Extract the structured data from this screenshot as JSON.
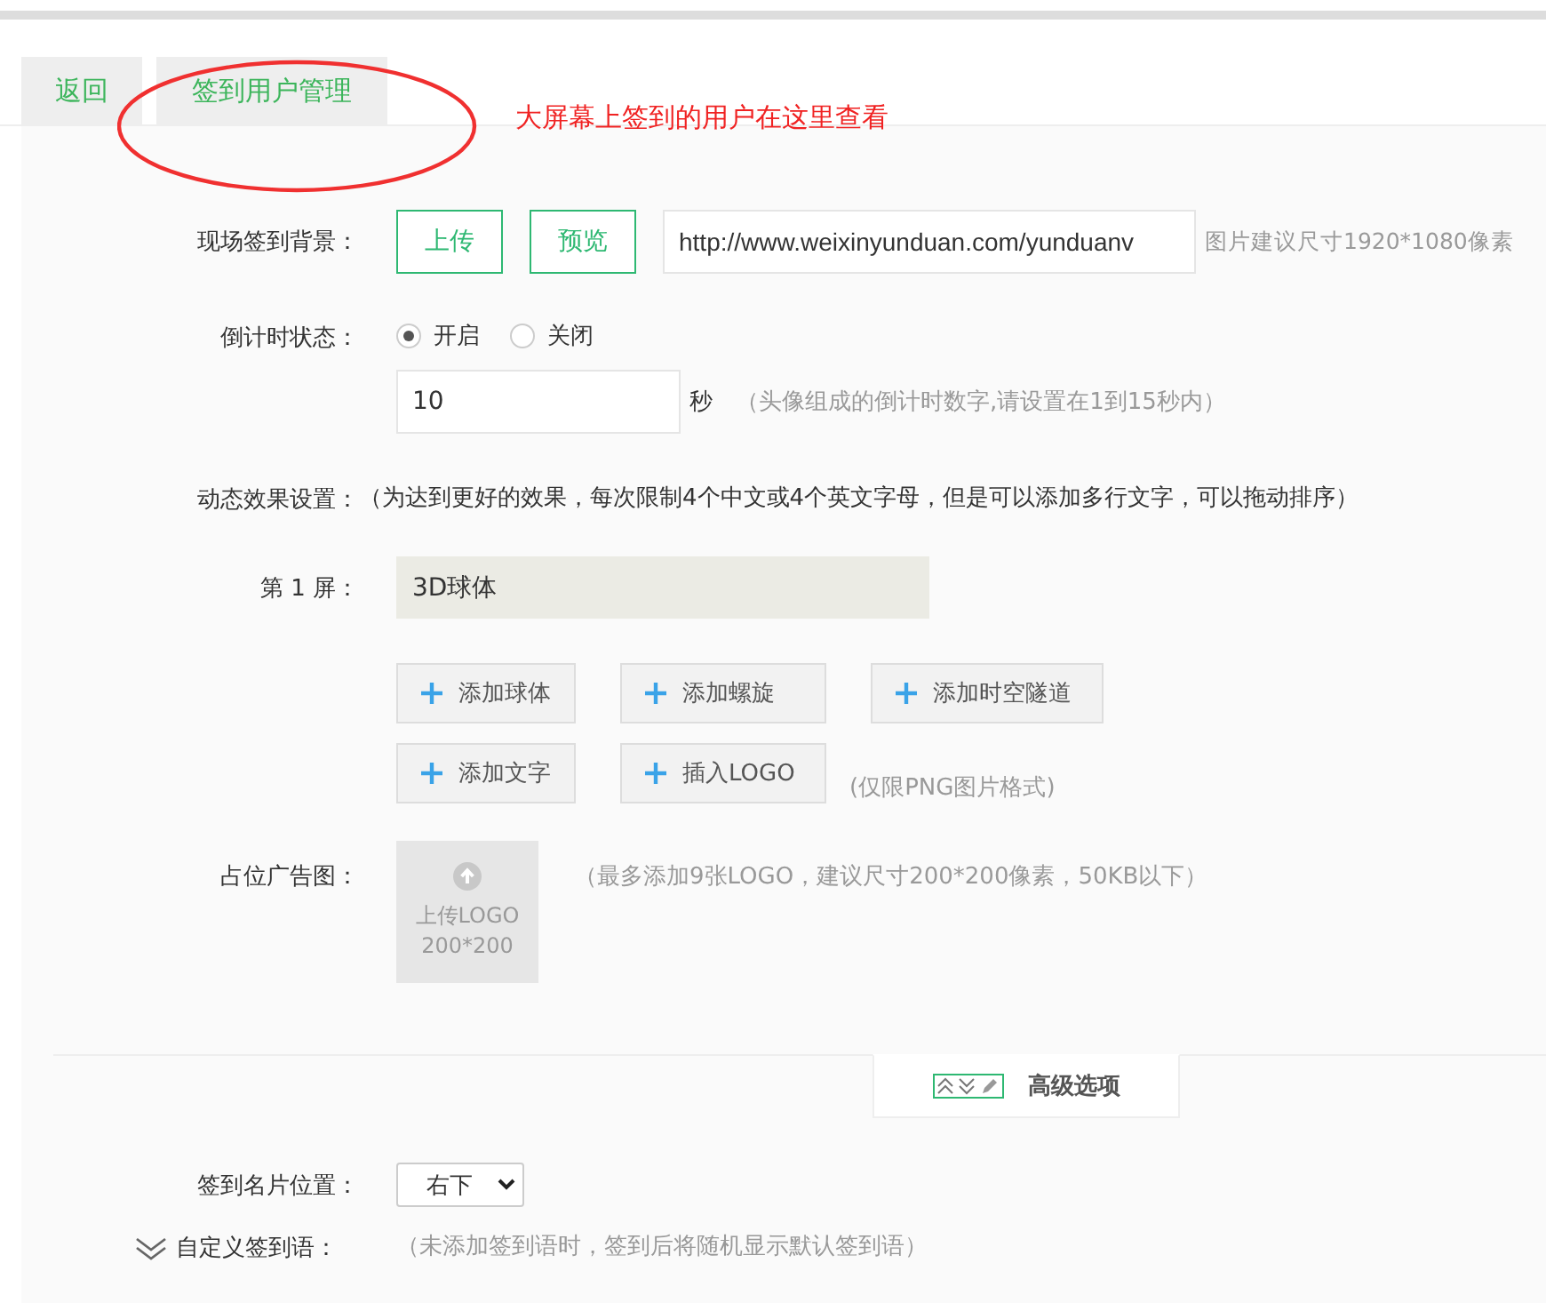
{
  "tabs": [
    {
      "label": "返回"
    },
    {
      "label": "签到用户管理"
    }
  ],
  "annotation": {
    "text": "大屏幕上签到的用户在这里查看"
  },
  "background": {
    "label": "现场签到背景：",
    "buttons": [
      "上传",
      "预览"
    ],
    "url": "http://www.weixinyunduan.com/yunduanv",
    "hint": "图片建议尺寸1920*1080像素"
  },
  "countdown": {
    "label": "倒计时状态：",
    "options": [
      {
        "label": "开启",
        "selected": true
      },
      {
        "label": "关闭",
        "selected": false
      }
    ],
    "value": "10",
    "unit": "秒",
    "hint": "（头像组成的倒计时数字,请设置在1到15秒内）"
  },
  "effects": {
    "label": "动态效果设置：",
    "hint": "（为达到更好的效果，每次限制4个中文或4个英文字母，但是可以添加多行文字，可以拖动排序）",
    "screens": [
      {
        "label": "第 1 屏：",
        "value": "3D球体"
      }
    ],
    "add_buttons": [
      "添加球体",
      "添加螺旋",
      "添加时空隧道",
      "添加文字",
      "插入LOGO"
    ],
    "logo_hint": "(仅限PNG图片格式)"
  },
  "ad": {
    "label": "占位广告图：",
    "upload": [
      "上传LOGO",
      "200*200"
    ],
    "hint": "（最多添加9张LOGO，建议尺寸200*200像素，50KB以下）"
  },
  "advanced": {
    "label": "高级选项"
  },
  "card_position": {
    "label": "签到名片位置：",
    "value": "右下"
  },
  "custom_greeting": {
    "label": "自定义签到语：",
    "hint": "（未添加签到语时，签到后将随机显示默认签到语）"
  }
}
